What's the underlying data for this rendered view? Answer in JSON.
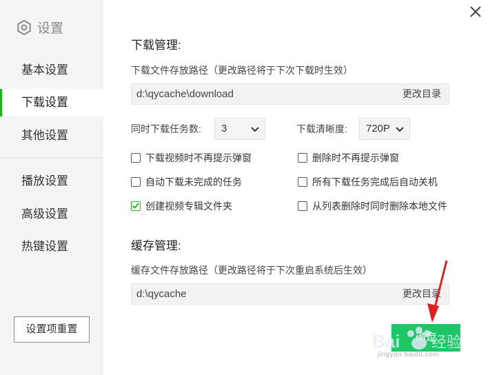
{
  "sidebar": {
    "title": "设置",
    "title_icon": "gear-icon",
    "items": [
      {
        "label": "基本设置",
        "active": false
      },
      {
        "label": "下载设置",
        "active": true
      },
      {
        "label": "其他设置",
        "active": false
      },
      {
        "label": "播放设置",
        "active": false
      },
      {
        "label": "高级设置",
        "active": false
      },
      {
        "label": "热键设置",
        "active": false
      }
    ],
    "reset_label": "设置项重置"
  },
  "close_icon": "close-icon",
  "download": {
    "heading": "下载管理:",
    "path_label": "下载文件存放路径（更改路径将于下次下载时生效）",
    "path_value": "d:\\qycache\\download",
    "change_label": "更改目录",
    "concurrent_label": "同时下载任务数:",
    "concurrent_value": "3",
    "quality_label": "下载清晰度:",
    "quality_value": "720P",
    "options": [
      {
        "label": "下载视频时不再提示弹窗",
        "checked": false
      },
      {
        "label": "删除时不再提示弹窗",
        "checked": false
      },
      {
        "label": "自动下载未完成的任务",
        "checked": false
      },
      {
        "label": "所有下载任务完成后自动关机",
        "checked": false
      },
      {
        "label": "创建视频专辑文件夹",
        "checked": true
      },
      {
        "label": "从列表删除时同时删除本地文件",
        "checked": false
      }
    ]
  },
  "cache": {
    "heading": "缓存管理:",
    "path_label": "缓存文件存放路径（更改路径将于下次重启系统后生效）",
    "path_value": "d:\\qycache",
    "change_label": "更改目录"
  },
  "ok_label": "确定",
  "watermark": "jingyan.baidu.com",
  "colors": {
    "accent": "#1cb51c",
    "button": "#1ec766",
    "arrow": "#e02020"
  }
}
